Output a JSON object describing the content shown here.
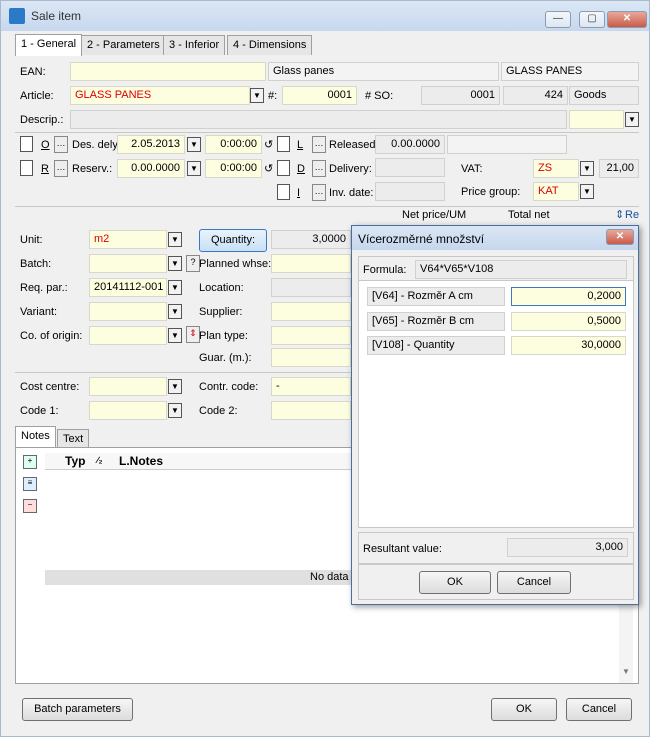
{
  "window": {
    "title": "Sale item",
    "min": "—",
    "max": "▢",
    "close": "✕"
  },
  "tabs": [
    "1 - General",
    "2 - Parameters",
    "3 - Inferior",
    "4 - Dimensions"
  ],
  "ean": {
    "label": "EAN:",
    "value": "",
    "name1": "Glass panes",
    "name2": "GLASS PANES"
  },
  "article": {
    "label": "Article:",
    "value": "GLASS PANES",
    "num_label": "#:",
    "num": "0001",
    "so_label": "# SO:",
    "so": "0001",
    "so2": "424",
    "type": "Goods"
  },
  "descr": {
    "label": "Descrip.:"
  },
  "row_o": {
    "key": "O",
    "label": "Des. dely",
    "date": "2.05.2013",
    "time": "0:00:00"
  },
  "row_r": {
    "key": "R",
    "label": "Reserv.:",
    "value": "0.00.0000",
    "time": "0:00:00"
  },
  "row_l": {
    "key": "L",
    "label": "Released",
    "value": "0.00.0000"
  },
  "row_d": {
    "key": "D",
    "label": "Delivery:"
  },
  "row_i": {
    "key": "I",
    "label": "Inv. date:"
  },
  "vat": {
    "label": "VAT:",
    "value": "ZS",
    "rate": "21,00"
  },
  "price_group": {
    "label": "Price group:",
    "value": "KAT"
  },
  "price_headers": {
    "net": "Net price/UM",
    "total": "Total net",
    "re": "Re"
  },
  "unit": {
    "label": "Unit:",
    "value": "m2"
  },
  "quantity": {
    "label": "Quantity:",
    "value": "3,0000"
  },
  "batch": {
    "label": "Batch:",
    "q": "?"
  },
  "planned_whse": {
    "label": "Planned whse:"
  },
  "req_par": {
    "label": "Req. par.:",
    "value": "20141112-001"
  },
  "location": {
    "label": "Location:"
  },
  "variant": {
    "label": "Variant:"
  },
  "supplier": {
    "label": "Supplier:"
  },
  "origin": {
    "label": "Co. of origin:"
  },
  "plan_type": {
    "label": "Plan type:"
  },
  "guar": {
    "label": "Guar. (m.):"
  },
  "cost_centre": {
    "label": "Cost centre:"
  },
  "contr_code": {
    "label": "Contr. code:",
    "value": "-"
  },
  "code1": {
    "label": "Code 1:"
  },
  "code2": {
    "label": "Code 2:"
  },
  "notes_tabs": [
    "Notes",
    "Text"
  ],
  "notes_grid": {
    "col1": "Typ",
    "col2": "L.Notes",
    "empty": "No data"
  },
  "buttons": {
    "batch": "Batch parameters",
    "ok": "OK",
    "cancel": "Cancel"
  },
  "dialog": {
    "title": "Vícerozměrné množství",
    "formula_label": "Formula:",
    "formula": "V64*V65*V108",
    "rows": [
      {
        "label": "[V64] - Rozměr A cm",
        "value": "0,2000"
      },
      {
        "label": "[V65] - Rozměr B cm",
        "value": "0,5000"
      },
      {
        "label": "[V108] - Quantity",
        "value": "30,0000"
      }
    ],
    "result_label": "Resultant value:",
    "result": "3,000",
    "ok": "OK",
    "cancel": "Cancel"
  }
}
